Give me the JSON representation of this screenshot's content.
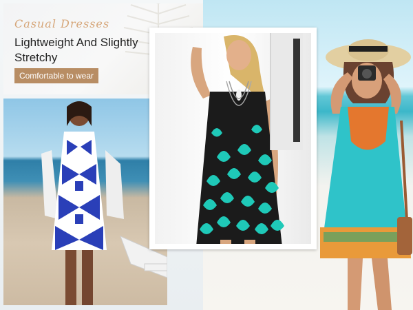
{
  "banner": {
    "script_title": "Casual Dresses",
    "headline_line1": "Lightweight And Slightly",
    "headline_line2": "Stretchy",
    "badge": "Comfortable to wear"
  },
  "colors": {
    "badge": "#b88d64",
    "script": "#d6a679",
    "dress_dark": "#1b1b1b",
    "dress_teal": "#1fc9b8",
    "dress_blue": "#2a3fb8"
  }
}
